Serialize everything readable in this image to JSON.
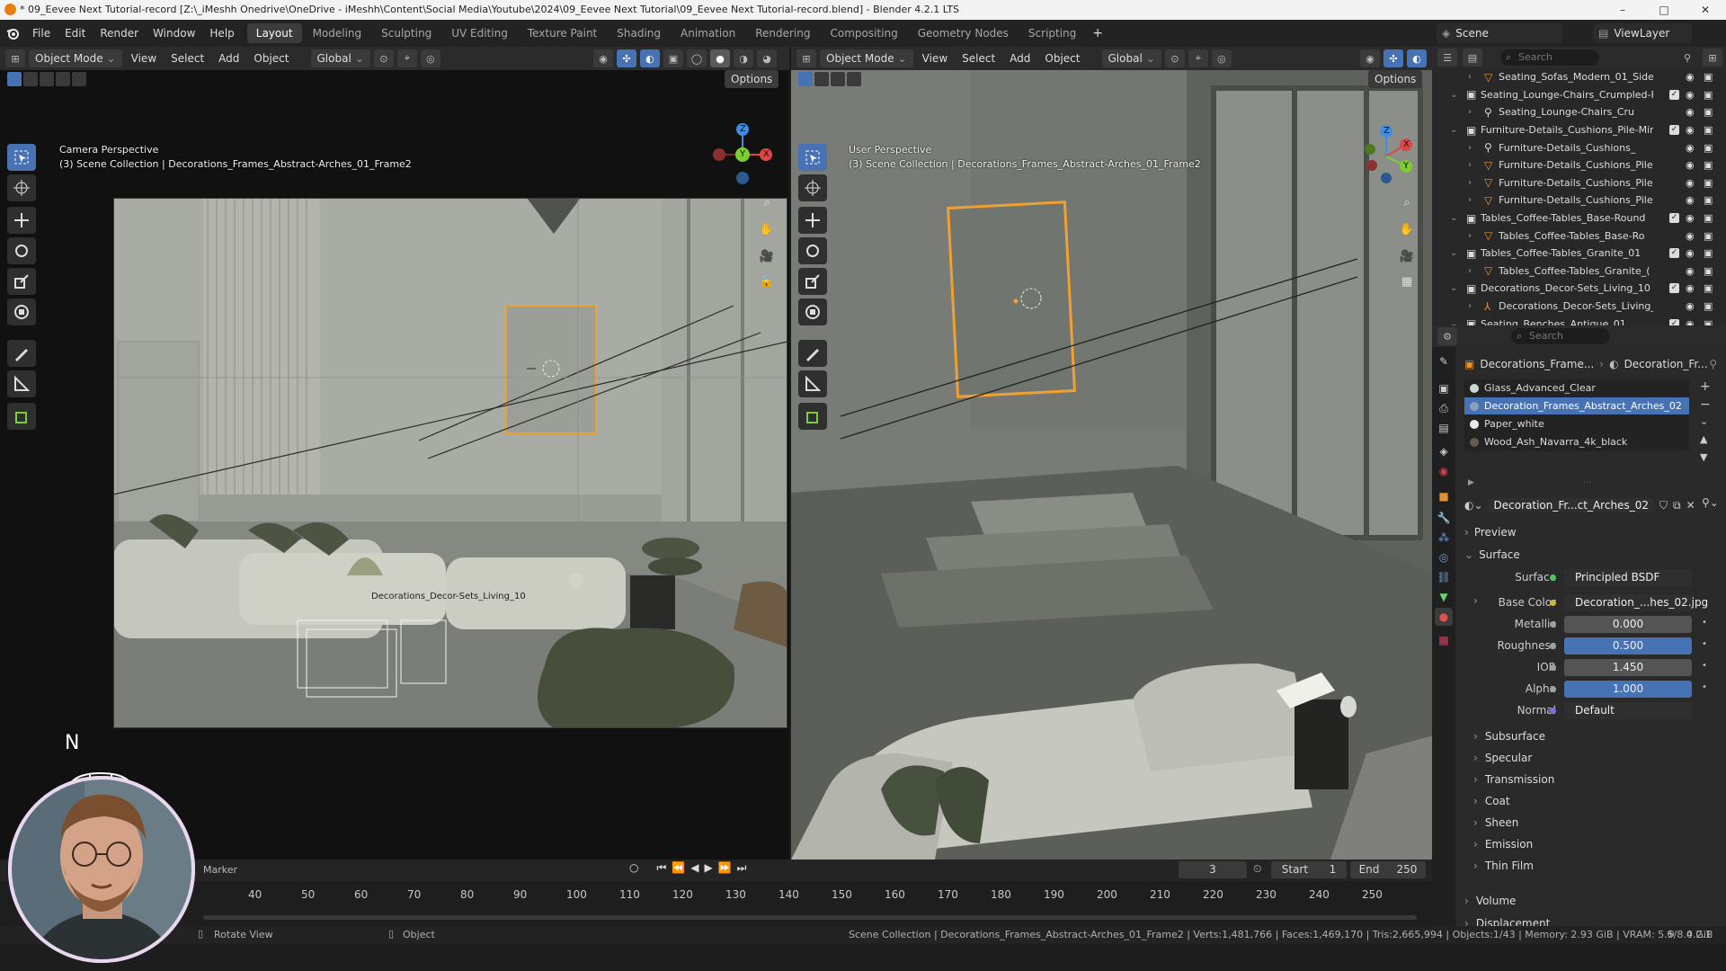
{
  "window": {
    "title": "* 09_Eevee Next Tutorial-record [Z:\\_iMeshh Onedrive\\OneDrive - iMeshh\\Content\\Social Media\\Youtube\\2024\\09_Eevee Next Tutorial\\09_Eevee Next Tutorial-record.blend] - Blender 4.2.1 LTS",
    "minimize": "–",
    "maximize": "□",
    "close": "✕"
  },
  "menu": [
    "File",
    "Edit",
    "Render",
    "Window",
    "Help"
  ],
  "workspaces": [
    {
      "label": "Layout",
      "active": true
    },
    {
      "label": "Modeling"
    },
    {
      "label": "Sculpting"
    },
    {
      "label": "UV Editing"
    },
    {
      "label": "Texture Paint"
    },
    {
      "label": "Shading"
    },
    {
      "label": "Animation"
    },
    {
      "label": "Rendering"
    },
    {
      "label": "Compositing"
    },
    {
      "label": "Geometry Nodes"
    },
    {
      "label": "Scripting"
    }
  ],
  "add_workspace": "+",
  "scene": {
    "label": "Scene",
    "viewlayer": "ViewLayer"
  },
  "viewport_left": {
    "mode": "Object Mode",
    "menus": [
      "View",
      "Select",
      "Add",
      "Object"
    ],
    "orientation": "Global",
    "options": "Options",
    "perspective": "Camera Perspective",
    "collection": "(3) Scene Collection | Decorations_Frames_Abstract-Arches_01_Frame2",
    "label_object": "Decorations_Decor-Sets_Living_10",
    "axis_x": "X",
    "axis_y": "Y",
    "axis_z": "Z",
    "north": "N"
  },
  "viewport_right": {
    "mode": "Object Mode",
    "menus": [
      "View",
      "Select",
      "Add",
      "Object"
    ],
    "orientation": "Global",
    "options": "Options",
    "perspective": "User Perspective",
    "collection": "(3) Scene Collection | Decorations_Frames_Abstract-Arches_01_Frame2",
    "axis_x": "X",
    "axis_y": "Y",
    "axis_z": "Z"
  },
  "outliner": {
    "search_placeholder": "Search",
    "rows": [
      {
        "indent": 2,
        "icon": "object",
        "text": "Seating_Sofas_Modern_01_Side"
      },
      {
        "indent": 1,
        "icon": "collection",
        "text": "Seating_Lounge-Chairs_Crumpled-F",
        "check": true
      },
      {
        "indent": 2,
        "icon": "armature",
        "text": "Seating_Lounge-Chairs_Cru"
      },
      {
        "indent": 1,
        "icon": "collection",
        "text": "Furniture-Details_Cushions_Pile-Min",
        "check": true
      },
      {
        "indent": 2,
        "icon": "armature",
        "text": "Furniture-Details_Cushions_"
      },
      {
        "indent": 2,
        "icon": "object",
        "text": "Furniture-Details_Cushions_Pile-"
      },
      {
        "indent": 2,
        "icon": "object",
        "text": "Furniture-Details_Cushions_Pile-"
      },
      {
        "indent": 2,
        "icon": "object",
        "text": "Furniture-Details_Cushions_Pile-"
      },
      {
        "indent": 1,
        "icon": "collection",
        "text": "Tables_Coffee-Tables_Base-Round",
        "check": true
      },
      {
        "indent": 2,
        "icon": "object",
        "text": "Tables_Coffee-Tables_Base-Ro"
      },
      {
        "indent": 1,
        "icon": "collection",
        "text": "Tables_Coffee-Tables_Granite_01",
        "check": true
      },
      {
        "indent": 2,
        "icon": "object",
        "text": "Tables_Coffee-Tables_Granite_("
      },
      {
        "indent": 1,
        "icon": "collection",
        "text": "Decorations_Decor-Sets_Living_10",
        "check": true
      },
      {
        "indent": 2,
        "icon": "empty",
        "text": "Decorations_Decor-Sets_Living_"
      },
      {
        "indent": 1,
        "icon": "collection",
        "text": "Seating_Benches_Antique_01",
        "check": true
      }
    ]
  },
  "properties": {
    "search_placeholder": "Search",
    "breadcrumb_object": "Decorations_Frame...",
    "breadcrumb_material": "Decoration_Fr...",
    "slots": [
      "Glass_Advanced_Clear",
      "Decoration_Frames_Abstract_Arches_02",
      "Paper_white",
      "Wood_Ash_Navarra_4k_black"
    ],
    "selected_slot": 1,
    "material_name": "Decoration_Fr...ct_Arches_02",
    "sections": {
      "preview": "Preview",
      "surface": "Surface"
    },
    "fields": [
      {
        "label": "Surface",
        "value": "Principled BSDF",
        "style": "dark",
        "dot": "#4fbf5f"
      },
      {
        "label": "Base Color",
        "value": "Decoration_...hes_02.jpg",
        "style": "dark",
        "dot": "#c9b93f"
      },
      {
        "label": "Metallic",
        "value": "0.000",
        "style": "grey"
      },
      {
        "label": "Roughness",
        "value": "0.500",
        "style": "blue"
      },
      {
        "label": "IOR",
        "value": "1.450",
        "style": "grey"
      },
      {
        "label": "Alpha",
        "value": "1.000",
        "style": "blue"
      },
      {
        "label": "Normal",
        "value": "Default",
        "style": "dark",
        "dot": "#7b6fd6"
      }
    ],
    "subsections": [
      "Subsurface",
      "Specular",
      "Transmission",
      "Coat",
      "Sheen",
      "Emission",
      "Thin Film"
    ],
    "more_sections": [
      "Volume",
      "Displacement"
    ]
  },
  "timeline": {
    "marker": "Marker",
    "ticks": [
      "40",
      "50",
      "60",
      "70",
      "80",
      "90",
      "100",
      "110",
      "120",
      "130",
      "140",
      "150",
      "160",
      "170",
      "180",
      "190",
      "200",
      "210",
      "220",
      "230",
      "240",
      "250"
    ],
    "current_frame": "3",
    "start_label": "Start",
    "start": "1",
    "end_label": "End",
    "end": "250"
  },
  "status": {
    "left_action": "Rotate View",
    "mid_action": "Object",
    "info": "Scene Collection | Decorations_Frames_Abstract-Arches_01_Frame2 | Verts:1,481,766 | Faces:1,469,170 | Tris:2,665,994 | Objects:1/43 | Memory: 2.93 GiB | VRAM: 5.5/8.0 GiB",
    "version": "4.2.1"
  },
  "colors": {
    "accent": "#4772b3",
    "selection": "#f0a030",
    "axis_x": "#e04646",
    "axis_y": "#7ccf31",
    "axis_z": "#3f8ee0"
  }
}
